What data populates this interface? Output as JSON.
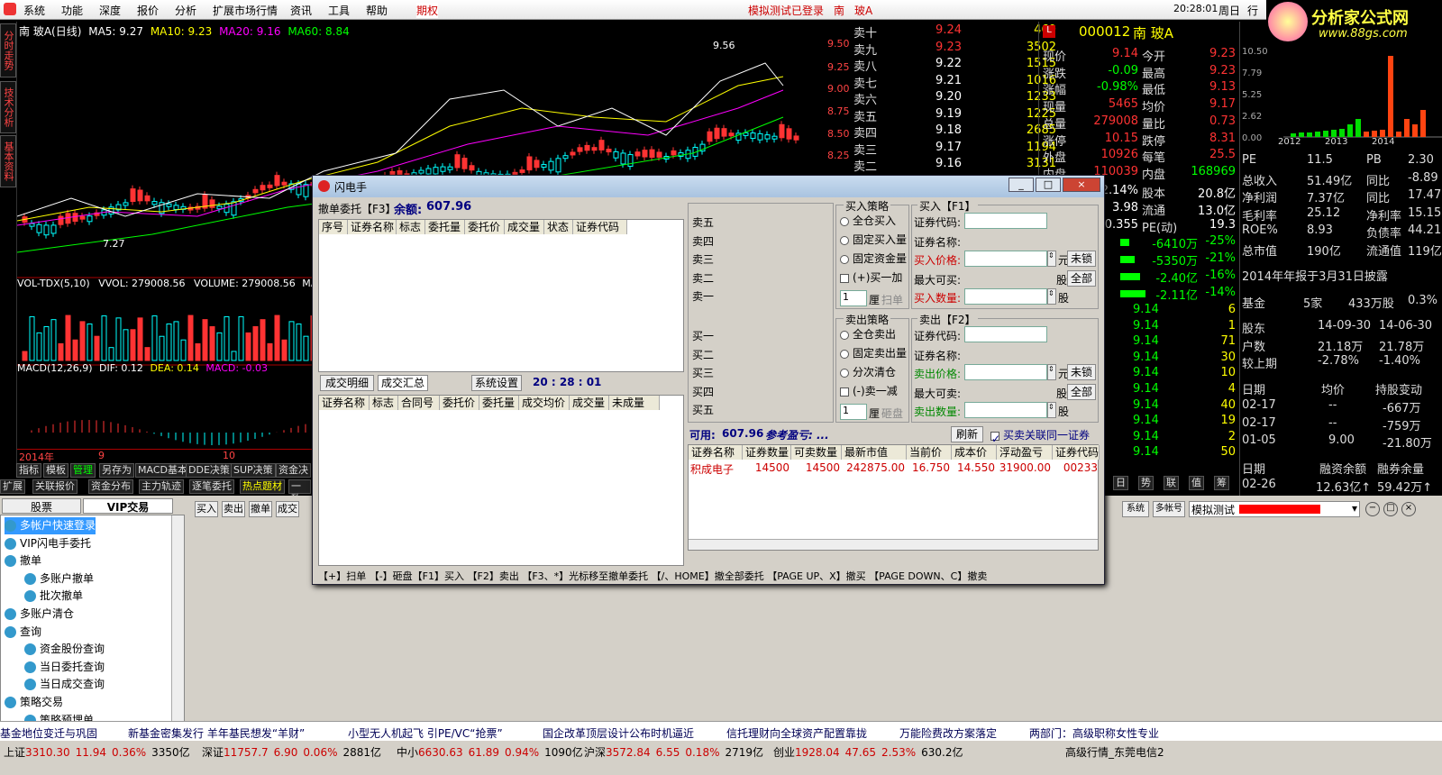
{
  "menu": {
    "items": [
      "系统",
      "功能",
      "深度",
      "报价",
      "分析",
      "扩展市场行情",
      "资讯",
      "工具",
      "帮助"
    ],
    "futures": "期权",
    "status": "模拟测试已登录",
    "stock_short": "南",
    "stock_name": "玻A",
    "clock": "20:28:01",
    "weekday": "周日",
    "tab_right": "行"
  },
  "brand": {
    "name": "分析家公式网",
    "url": "www.88gs.com"
  },
  "chart": {
    "header": "南  玻A(日线)",
    "ma5": "MA5: 9.27",
    "ma10": "MA10: 9.23",
    "ma20": "MA20: 9.16",
    "ma60": "MA60: 8.84",
    "high_mark": "9.56",
    "low_mark": "7.27",
    "vol_label": "VOL-TDX(5,10)",
    "vvol": "VVOL: 279008.56",
    "volume": "VOLUME: 279008.56",
    "mav": "MAV",
    "macd_label": "MACD(12,26,9)",
    "dif": "DIF: 0.12",
    "dea": "DEA: 0.14",
    "macd": "MACD: -0.03",
    "x_labels": [
      "2014年",
      "9",
      "10"
    ],
    "y_labels": [
      "9.50",
      "9.25",
      "9.00",
      "8.75",
      "8.50",
      "8.25"
    ],
    "side_tabs": [
      "分时走势",
      "技术分析",
      "基本资料"
    ],
    "bottom_tabs1": [
      "指标",
      "模板",
      "管理",
      "另存为",
      "MACD基本",
      "DDE决策",
      "SUP决策",
      "资金决"
    ],
    "bottom_tabs2": [
      "扩展",
      "关联报价",
      "资金分布",
      "主力轨迹",
      "逐笔委托",
      "热点题材",
      "一致"
    ]
  },
  "book": {
    "rows": [
      {
        "n": "卖十",
        "p": "9.24",
        "v": "469"
      },
      {
        "n": "卖九",
        "p": "9.23",
        "v": "3502"
      },
      {
        "n": "卖八",
        "p": "9.22",
        "v": "1515"
      },
      {
        "n": "卖七",
        "p": "9.21",
        "v": "1016"
      },
      {
        "n": "卖六",
        "p": "9.20",
        "v": "1233"
      },
      {
        "n": "卖五",
        "p": "9.19",
        "v": "1225"
      },
      {
        "n": "卖四",
        "p": "9.18",
        "v": "2685"
      },
      {
        "n": "卖三",
        "p": "9.17",
        "v": "1194"
      },
      {
        "n": "卖二",
        "p": "9.16",
        "v": "3131"
      }
    ]
  },
  "quote": {
    "code": "000012",
    "name": "南 玻A",
    "rows": [
      [
        "现价",
        "9.14",
        "今开",
        "9.23"
      ],
      [
        "涨跌",
        "-0.09",
        "最高",
        "9.23"
      ],
      [
        "涨幅",
        "-0.98%",
        "最低",
        "9.13"
      ],
      [
        "现量",
        "5465",
        "均价",
        "9.17"
      ],
      [
        "总量",
        "279008",
        "量比",
        "0.73"
      ],
      [
        "涨停",
        "10.15",
        "跌停",
        "8.31"
      ],
      [
        "外盘",
        "10926",
        "每笔",
        "25.5"
      ],
      [
        "内盘",
        "110039",
        "内盘",
        "168969"
      ]
    ],
    "rows2": [
      [
        "2.14%",
        "股本",
        "20.8亿"
      ],
      [
        "3.98",
        "流通",
        "13.0亿"
      ],
      [
        "0.355",
        "PE(动)",
        "19.3"
      ]
    ],
    "flows": [
      [
        "-6410万",
        "-25%"
      ],
      [
        "-5350万",
        "-21%"
      ],
      [
        "-2.40亿",
        "-16%"
      ],
      [
        "-2.11亿",
        "-14%"
      ]
    ],
    "ticks": [
      [
        "9.14",
        "6"
      ],
      [
        "9.14",
        "1"
      ],
      [
        "9.14",
        "71"
      ],
      [
        "9.14",
        "30"
      ],
      [
        "9.14",
        "10"
      ],
      [
        "9.14",
        "4"
      ],
      [
        "9.14",
        "40"
      ],
      [
        "9.14",
        "19"
      ],
      [
        "9.14",
        "2"
      ],
      [
        "9.14",
        "50"
      ]
    ],
    "tabs": [
      "日",
      "势",
      "联",
      "值",
      "筹"
    ]
  },
  "rpanel": {
    "years": [
      "2012",
      "2013",
      "2014"
    ],
    "axis": [
      "10.50",
      "7.79",
      "5.25",
      "2.62",
      "0.00"
    ],
    "fin": [
      [
        "PE",
        "11.5",
        "PB",
        "2.30"
      ],
      [
        "总收入",
        "51.49亿",
        "同比",
        "-8.89"
      ],
      [
        "净利润",
        "7.37亿",
        "同比",
        "17.47"
      ],
      [
        "毛利率",
        "25.12",
        "净利率",
        "15.15"
      ],
      [
        "ROE%",
        "8.93",
        "负债率",
        "44.21"
      ],
      [
        "总市值",
        "190亿",
        "流通值",
        "119亿"
      ]
    ],
    "report": "2014年年报于3月31日披露",
    "fund": [
      "基金",
      "5家",
      "433万股",
      "0.3%"
    ],
    "holders": [
      [
        "股东",
        "14-09-30",
        "14-06-30"
      ],
      [
        "户数",
        "21.18万",
        "21.78万"
      ],
      [
        "较上期",
        "-2.78%",
        "-1.40%"
      ]
    ],
    "funds_hdr": [
      "日期",
      "均价",
      "持股变动"
    ],
    "funds_rows": [
      [
        "02-17",
        "--",
        "-667万"
      ],
      [
        "02-17",
        "--",
        "-759万"
      ],
      [
        "01-05",
        "9.00",
        "-21.80万"
      ]
    ],
    "margin_hdr": [
      "日期",
      "融资余额",
      "融券余量"
    ],
    "margin_row": [
      "02-26",
      "12.63亿↑",
      "59.42万↑"
    ]
  },
  "lower": {
    "tabs": [
      "股票",
      "VIP交易"
    ],
    "tree": [
      "多帐户快速登录",
      "VIP闪电手委托",
      "撤单",
      "多账户撤单",
      "批次撤单",
      "多账户清仓",
      "查询",
      "资金股份查询",
      "当日委托查询",
      "当日成交查询",
      "策略交易",
      "策略预埋单"
    ],
    "toolbar": [
      "买入",
      "卖出",
      "撤单",
      "成交"
    ],
    "right_btns": [
      "系统",
      "多帐号"
    ],
    "account": "模拟测试"
  },
  "dialog": {
    "title": "闪电手",
    "cancel_label": "撤单委托【F3】",
    "balance_label": "余额:",
    "balance": "607.96",
    "cols1": [
      "序号",
      "证券名称",
      "标志",
      "委托量",
      "委托价",
      "成交量",
      "状态",
      "证券代码"
    ],
    "tab_detail": "成交明细",
    "tab_summary": "成交汇总",
    "settings": "系统设置",
    "time": "20 : 28 : 01",
    "cols2": [
      "证券名称",
      "标志",
      "合同号",
      "委托价",
      "委托量",
      "成交均价",
      "成交量",
      "未成量"
    ],
    "sells": [
      "卖五",
      "卖四",
      "卖三",
      "卖二",
      "卖一"
    ],
    "buys": [
      "买一",
      "买二",
      "买三",
      "买四",
      "买五"
    ],
    "buy_strategy": "买入策略",
    "buy_opts": [
      "全仓买入",
      "固定买入量",
      "固定资金量",
      "(+)买一加"
    ],
    "scan": "扫单",
    "tick_unit": "厘",
    "qty_1": "1",
    "buy_hdr": "买入【F1】",
    "sec_code": "证券代码:",
    "sec_name": "证券名称:",
    "buy_price": "买入价格:",
    "max_buy": "最大可买:",
    "buy_qty": "买入数量:",
    "yuan": "元",
    "gu": "股",
    "unlock": "未锁",
    "all": "全部",
    "sell_strategy": "卖出策略",
    "sell_opts": [
      "全仓卖出",
      "固定卖出量",
      "分次清仓",
      "(-)卖一减"
    ],
    "smash": "砸盘",
    "sell_hdr": "卖出【F2】",
    "sell_price": "卖出价格:",
    "max_sell": "最大可卖:",
    "sell_qty": "卖出数量:",
    "avail_label": "可用:",
    "avail": "607.96",
    "ref_pl": "参考盈亏: ...",
    "refresh": "刷新",
    "link": "买卖关联同一证券",
    "cols3": [
      "证券名称",
      "证券数量",
      "可卖数量",
      "最新市值",
      "当前价",
      "成本价",
      "浮动盈亏",
      "证券代码"
    ],
    "hold": [
      "积成电子",
      "14500",
      "14500",
      "242875.00",
      "16.750",
      "14.550",
      "31900.00",
      "00233"
    ],
    "hotkeys": "【+】扫单 【-】砸盘【F1】买入 【F2】卖出 【F3、*】光标移至撤单委托 【/、HOME】撤全部委托 【PAGE UP、X】撤买 【PAGE DOWN、C】撤卖"
  },
  "news": [
    "基金地位变迁与巩固",
    "新基金密集发行 羊年基民想发“羊财”",
    "小型无人机起飞 引PE/VC“抢票”",
    "国企改革顶层设计公布时机逼近",
    "信托理财向全球资产配置靠拢",
    "万能险费改方案落定",
    "两部门：高级职称女性专业"
  ],
  "indices": [
    {
      "n": "上证",
      "v": "3310.30",
      "c": "11.94",
      "p": "0.36%",
      "a": "3350亿"
    },
    {
      "n": "深证",
      "v": "11757.7",
      "c": "6.90",
      "p": "0.06%",
      "a": "2881亿"
    },
    {
      "n": "中小",
      "v": "6630.63",
      "c": "61.89",
      "p": "0.94%",
      "a": "1090亿"
    },
    {
      "n": "沪深",
      "v": "3572.84",
      "c": "6.55",
      "p": "0.18%",
      "a": "2719亿"
    },
    {
      "n": "创业",
      "v": "1928.04",
      "c": "47.65",
      "p": "2.53%",
      "a": "630.2亿"
    }
  ],
  "provider": "高级行情_东莞电信2",
  "colors": {
    "up": "#ff3333",
    "down": "#00ff00",
    "price": "#ffff00",
    "title_blue": "#000080"
  }
}
